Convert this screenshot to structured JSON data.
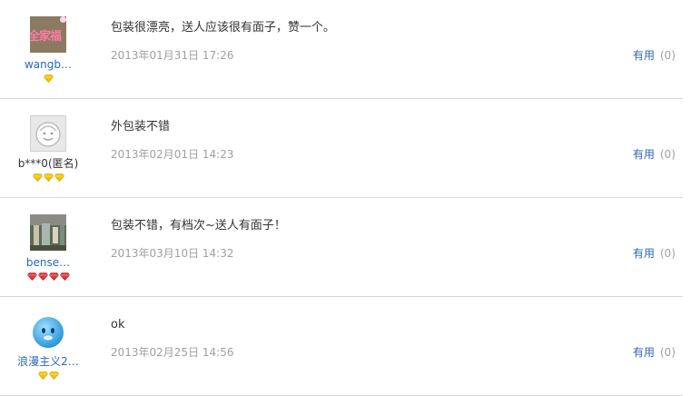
{
  "reviews": [
    {
      "username": "wangb…",
      "avatar_text": "全家福",
      "avatar": "photo-avatar",
      "level": {
        "count": 1,
        "icon": "gold-diamond-icon",
        "color": "#f5c400"
      },
      "content": "包装很漂亮，送人应该很有面子，赞一个。",
      "time": "2013年01月31日 17:26",
      "useful_label": "有用",
      "useful_count": "(0)"
    },
    {
      "username": "b***0(匿名)",
      "avatar": "anonymous-face-avatar",
      "level": {
        "count": 3,
        "icon": "gold-diamond-icon",
        "color": "#f5c400"
      },
      "content": "外包装不错",
      "time": "2013年02月01日 14:23",
      "useful_label": "有用",
      "useful_count": "(0)"
    },
    {
      "username": "bense…",
      "avatar": "photo-avatar",
      "level": {
        "count": 4,
        "icon": "red-diamond-icon",
        "color": "#e0343c"
      },
      "content": "包装不错，有档次~送人有面子！",
      "time": "2013年03月10日 14:32",
      "useful_label": "有用",
      "useful_count": "(0)"
    },
    {
      "username": "浪漫主义2…",
      "avatar": "blue-penguin-avatar",
      "level": {
        "count": 2,
        "icon": "gold-diamond-icon",
        "color": "#f5c400"
      },
      "content": "ok",
      "time": "2013年02月25日 14:56",
      "useful_label": "有用",
      "useful_count": "(0)"
    }
  ]
}
